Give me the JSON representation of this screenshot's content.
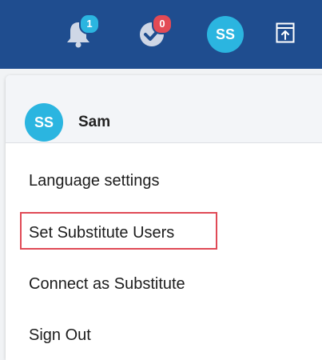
{
  "header": {
    "notifications_count": "1",
    "tasks_count": "0",
    "user_initials": "SS"
  },
  "menu": {
    "user_initials": "SS",
    "user_name": "Sam",
    "items": [
      {
        "label": "Language settings"
      },
      {
        "label": "Set Substitute Users"
      },
      {
        "label": "Connect as Substitute"
      },
      {
        "label": "Sign Out"
      }
    ]
  },
  "colors": {
    "topbar": "#1f4d8f",
    "avatar": "#2bb5e0",
    "badge_notifications": "#2bb5e0",
    "badge_tasks": "#e34a55",
    "highlight": "#e04a56"
  },
  "icons": {
    "notifications": "bell-icon",
    "tasks": "check-badge-icon",
    "panel": "panel-toggle-icon"
  }
}
